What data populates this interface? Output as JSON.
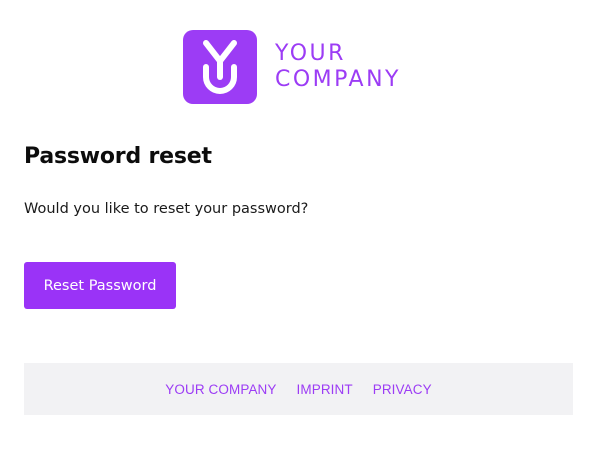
{
  "brand": {
    "accent_color": "#9c3cf5",
    "logo_icon": "yu-monogram-icon",
    "name_line1": "YOUR",
    "name_line2": "COMPANY"
  },
  "content": {
    "title": "Password reset",
    "message": "Would you like to reset your password?",
    "button_label": "Reset Password"
  },
  "footer": {
    "links": [
      "YOUR COMPANY",
      "IMPRINT",
      "PRIVACY"
    ]
  }
}
